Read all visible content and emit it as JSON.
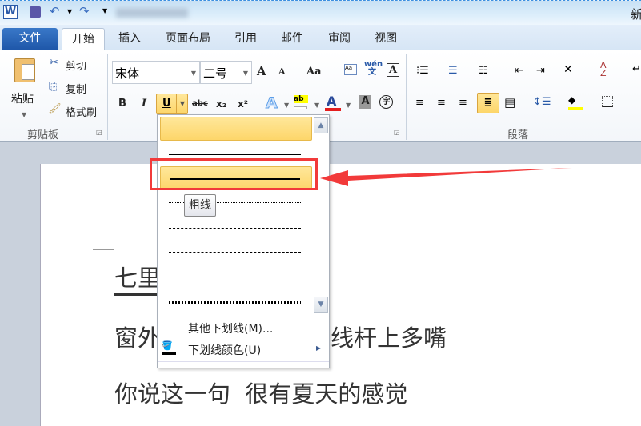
{
  "titlebar": {
    "title_partial": "新"
  },
  "tabs": {
    "file": "文件",
    "items": [
      "开始",
      "插入",
      "页面布局",
      "引用",
      "邮件",
      "审阅",
      "视图"
    ]
  },
  "clipboard": {
    "paste": "粘贴",
    "cut": "剪切",
    "copy": "复制",
    "format_painter": "格式刷",
    "group_label": "剪贴板"
  },
  "font": {
    "name": "宋体",
    "size": "二号",
    "bold": "B",
    "italic": "I",
    "underline": "U",
    "strike": "abc",
    "subscript": "x₂",
    "superscript": "x²",
    "grow": "A",
    "shrink": "A",
    "change_case": "Aa",
    "phonetic": "wén 文",
    "border_char": "A",
    "shade_char": "A",
    "enclose": "字",
    "font_color": "#e41e1e",
    "highlight_color": "#ffff00"
  },
  "paragraph": {
    "group_label": "段落"
  },
  "underline_menu": {
    "options": [
      "single",
      "double",
      "thick",
      "dotted",
      "dashed",
      "dash-dot",
      "dash-dot-dot",
      "wave"
    ],
    "selected": "thick",
    "tooltip": "粗线",
    "more": "其他下划线(M)...",
    "color": "下划线颜色(U)"
  },
  "annotation": {
    "color": "#f23a3a"
  },
  "document": {
    "line1": "七里",
    "line2_left": "窗外",
    "line2_right": "线杆上多嘴",
    "line3": "你说这一句  很有夏天的感觉"
  }
}
